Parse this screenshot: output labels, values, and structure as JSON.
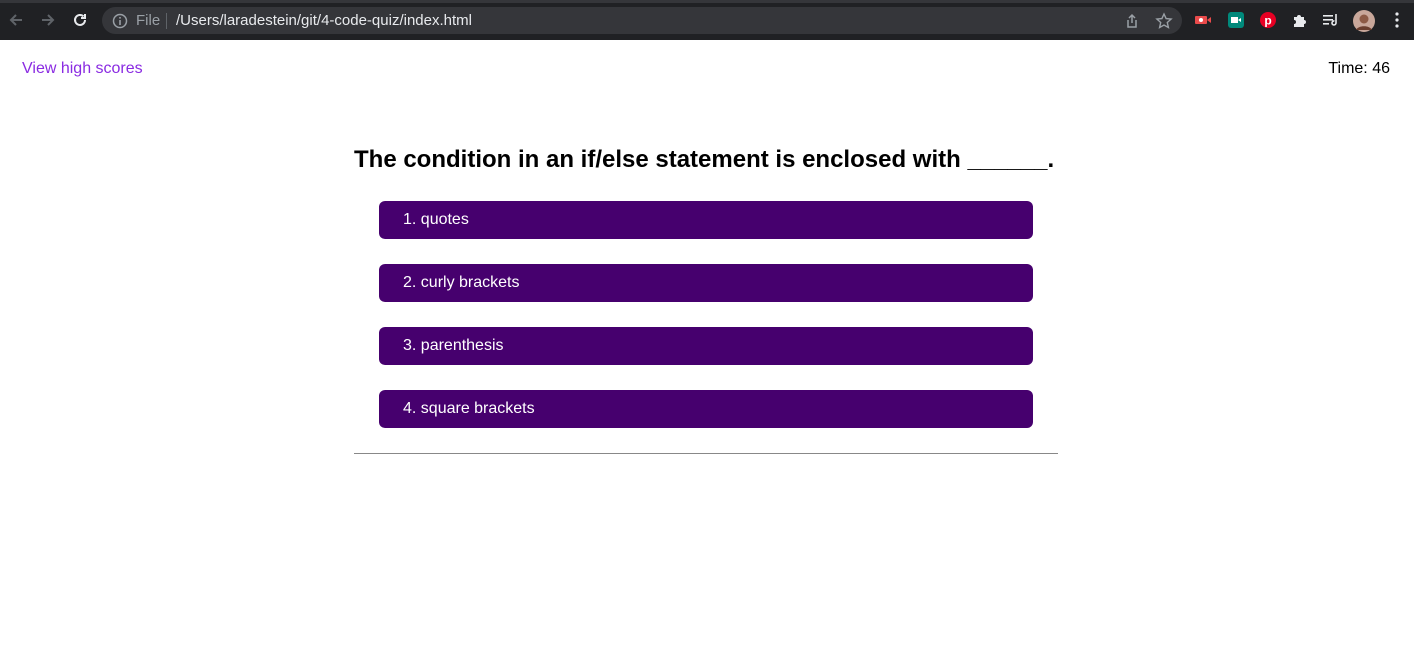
{
  "browser": {
    "file_label": "File",
    "url": "/Users/laradestein/git/4-code-quiz/index.html",
    "icons": [
      "back-icon",
      "forward-icon",
      "reload-icon",
      "info-icon",
      "share-icon",
      "bookmark-star-icon",
      "video-extension-icon",
      "meet-extension-icon",
      "pinterest-extension-icon",
      "extensions-puzzle-icon",
      "reading-list-icon",
      "profile-avatar",
      "menu-kebab-icon"
    ]
  },
  "header": {
    "high_scores_link": "View high scores",
    "timer_label": "Time: ",
    "timer_value": "46"
  },
  "quiz": {
    "question": "The condition in an if/else statement is enclosed with ______.",
    "answers": [
      {
        "label": "1. quotes"
      },
      {
        "label": "2. curly brackets"
      },
      {
        "label": "3. parenthesis"
      },
      {
        "label": "4. square brackets"
      }
    ]
  },
  "colors": {
    "answer_bg": "#46006e",
    "link": "#8a2be2",
    "chrome_bg": "#202124"
  }
}
